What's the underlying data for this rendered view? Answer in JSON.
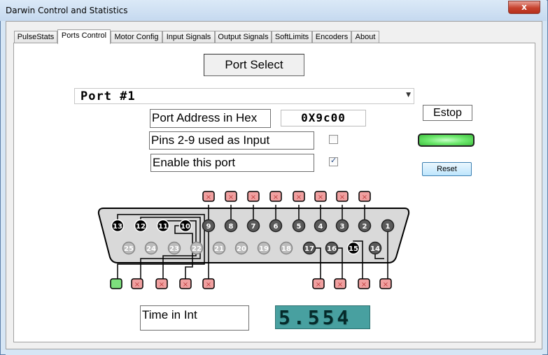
{
  "window": {
    "title": "Darwin Control and Statistics",
    "close_glyph": "x"
  },
  "tabs": [
    {
      "label": "PulseStats",
      "active": false
    },
    {
      "label": "Ports Control",
      "active": true
    },
    {
      "label": "Motor Config",
      "active": false
    },
    {
      "label": "Input Signals",
      "active": false
    },
    {
      "label": "Output Signals",
      "active": false
    },
    {
      "label": "SoftLimits",
      "active": false
    },
    {
      "label": "Encoders",
      "active": false
    },
    {
      "label": "About",
      "active": false
    }
  ],
  "ports": {
    "port_select_label": "Port Select",
    "selected_port": "Port #1",
    "address_label": "Port Address in Hex",
    "address_value": "0X9c00",
    "input_pins_label": "Pins 2-9 used as Input",
    "input_pins_checked": false,
    "enable_label": "Enable this port",
    "enable_checked": true,
    "estop_label": "Estop",
    "estop_led_color": "#6de86d",
    "reset_label": "Reset",
    "time_label": "Time in Int",
    "time_value": "5.554"
  },
  "connector": {
    "top_row": [
      "13",
      "12",
      "11",
      "10",
      "9",
      "8",
      "7",
      "6",
      "5",
      "4",
      "3",
      "2",
      "1"
    ],
    "bottom_row": [
      "25",
      "24",
      "23",
      "22",
      "21",
      "20",
      "19",
      "18",
      "17",
      "16",
      "15",
      "14"
    ],
    "black_pins": [
      "13",
      "12",
      "11",
      "10",
      "15"
    ],
    "dark_pins": [
      "9",
      "8",
      "7",
      "6",
      "5",
      "4",
      "3",
      "2",
      "1",
      "17",
      "16",
      "14"
    ],
    "light_pins": [
      "25",
      "24",
      "23",
      "22",
      "21",
      "20",
      "19",
      "18"
    ],
    "led_on_color": "#7de07d",
    "led_off_color": "#f0a0a0",
    "top_leds": [
      "off",
      "off",
      "off",
      "off",
      "off",
      "off",
      "off",
      "off"
    ],
    "bottom_leds": [
      "on",
      "off",
      "off",
      "off",
      "off",
      "off",
      "off",
      "off",
      "off"
    ]
  }
}
